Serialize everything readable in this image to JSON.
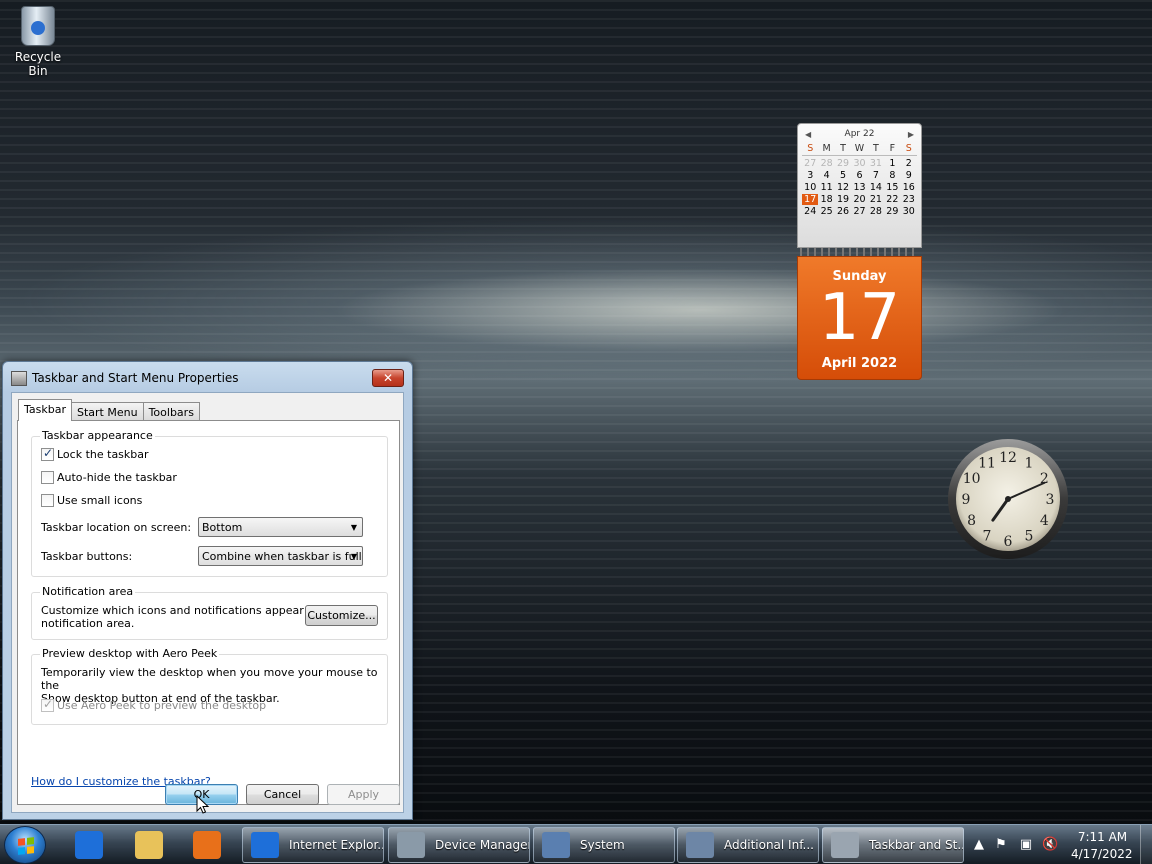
{
  "desktop": {
    "icons": [
      {
        "label": "Recycle Bin",
        "icon": "recycle-bin-icon"
      }
    ]
  },
  "calendar_gadget": {
    "month_label": "Apr 22",
    "weekdays": [
      "S",
      "M",
      "T",
      "W",
      "T",
      "F",
      "S"
    ],
    "weeks": [
      [
        "27",
        "28",
        "29",
        "30",
        "31",
        "1",
        "2"
      ],
      [
        "3",
        "4",
        "5",
        "6",
        "7",
        "8",
        "9"
      ],
      [
        "10",
        "11",
        "12",
        "13",
        "14",
        "15",
        "16"
      ],
      [
        "17",
        "18",
        "19",
        "20",
        "21",
        "22",
        "23"
      ],
      [
        "24",
        "25",
        "26",
        "27",
        "28",
        "29",
        "30"
      ]
    ],
    "today": "17",
    "day_name": "Sunday",
    "day_number": "17",
    "month_year": "April 2022"
  },
  "clock_gadget": {
    "numerals": [
      "12",
      "1",
      "2",
      "3",
      "4",
      "5",
      "6",
      "7",
      "8",
      "9",
      "10",
      "11"
    ],
    "time_display": "7:11"
  },
  "dialog": {
    "title": "Taskbar and Start Menu Properties",
    "close_label": "✕",
    "tabs": [
      {
        "label": "Taskbar",
        "active": true
      },
      {
        "label": "Start Menu",
        "active": false
      },
      {
        "label": "Toolbars",
        "active": false
      }
    ],
    "appearance": {
      "title": "Taskbar appearance",
      "lock": {
        "label": "Lock the taskbar",
        "checked": true
      },
      "autohide": {
        "label": "Auto-hide the taskbar",
        "checked": false
      },
      "small_icons": {
        "label": "Use small icons",
        "checked": false
      },
      "location_label": "Taskbar location on screen:",
      "location_value": "Bottom",
      "buttons_label": "Taskbar buttons:",
      "buttons_value": "Combine when taskbar is full"
    },
    "notification": {
      "title": "Notification area",
      "desc_line1": "Customize which icons and notifications appear in the",
      "desc_line2": "notification area.",
      "customize_label": "Customize..."
    },
    "aero_peek": {
      "title": "Preview desktop with Aero Peek",
      "desc_line1": "Temporarily view the desktop when you move your mouse to the",
      "desc_line2": "Show desktop button at end of the taskbar.",
      "use_label": "Use Aero Peek to preview the desktop",
      "use_checked": true,
      "use_disabled": true
    },
    "help_link": "How do I customize the taskbar?",
    "ok_label": "OK",
    "cancel_label": "Cancel",
    "apply_label": "Apply"
  },
  "taskbar": {
    "pinned": [
      {
        "name": "internet-explorer-icon",
        "color": "#1e6fd9"
      },
      {
        "name": "windows-explorer-icon",
        "color": "#e8c25a"
      },
      {
        "name": "media-player-icon",
        "color": "#e8701a"
      }
    ],
    "tasks": [
      {
        "label": "Internet Explor...",
        "icon": "internet-explorer-icon",
        "color": "#1e6fd9"
      },
      {
        "label": "Device Manager",
        "icon": "device-manager-icon",
        "color": "#8a9aa8"
      },
      {
        "label": "System",
        "icon": "system-icon",
        "color": "#5a7fb0"
      },
      {
        "label": "Additional Inf...",
        "icon": "additional-info-icon",
        "color": "#6d86a6"
      },
      {
        "label": "Taskbar and St...",
        "icon": "taskbar-properties-icon",
        "color": "#9aa5b0"
      }
    ],
    "tray": {
      "time": "7:11 AM",
      "date": "4/17/2022"
    }
  }
}
